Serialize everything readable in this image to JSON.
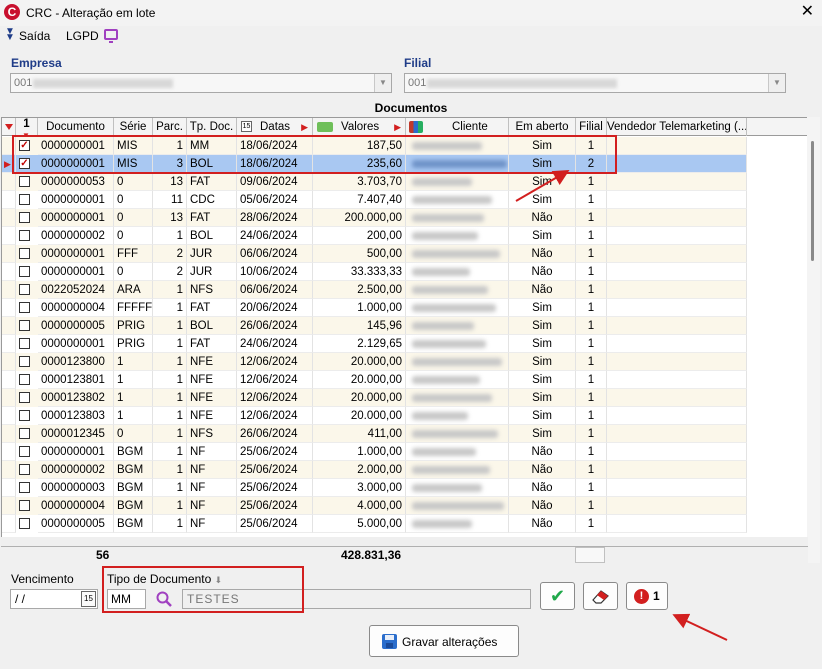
{
  "window": {
    "title": "CRC - Alteração em lote",
    "logo_letter": "C",
    "close_glyph": "✕"
  },
  "toolbar": {
    "exit_label": "Saída",
    "lgpd_label": "LGPD"
  },
  "empresa": {
    "label": "Empresa",
    "code": "001"
  },
  "filial": {
    "label": "Filial",
    "code": "001"
  },
  "grid": {
    "title": "Documentos",
    "select_count": "1",
    "columns": [
      "Documento",
      "Série",
      "Parc.",
      "Tp. Doc.",
      "Datas",
      "Valores",
      "Cliente",
      "Em aberto",
      "Filial",
      "Vendedor Telemarketing (..."
    ],
    "rows": [
      {
        "checked": true,
        "documento": "0000000001",
        "serie": "MIS",
        "parc": "1",
        "tp_doc": "MM",
        "data": "18/06/2024",
        "valor": "187,50",
        "em_aberto": "Sim",
        "filial": "1"
      },
      {
        "checked": true,
        "documento": "0000000001",
        "serie": "MIS",
        "parc": "3",
        "tp_doc": "BOL",
        "data": "18/06/2024",
        "valor": "235,60",
        "em_aberto": "Sim",
        "filial": "2"
      },
      {
        "checked": false,
        "documento": "0000000053",
        "serie": "0",
        "parc": "13",
        "tp_doc": "FAT",
        "data": "09/06/2024",
        "valor": "3.703,70",
        "em_aberto": "Sim",
        "filial": "1"
      },
      {
        "checked": false,
        "documento": "0000000001",
        "serie": "0",
        "parc": "11",
        "tp_doc": "CDC",
        "data": "05/06/2024",
        "valor": "7.407,40",
        "em_aberto": "Sim",
        "filial": "1"
      },
      {
        "checked": false,
        "documento": "0000000001",
        "serie": "0",
        "parc": "13",
        "tp_doc": "FAT",
        "data": "28/06/2024",
        "valor": "200.000,00",
        "em_aberto": "Não",
        "filial": "1"
      },
      {
        "checked": false,
        "documento": "0000000002",
        "serie": "0",
        "parc": "1",
        "tp_doc": "BOL",
        "data": "24/06/2024",
        "valor": "200,00",
        "em_aberto": "Sim",
        "filial": "1"
      },
      {
        "checked": false,
        "documento": "0000000001",
        "serie": "FFF",
        "parc": "2",
        "tp_doc": "JUR",
        "data": "06/06/2024",
        "valor": "500,00",
        "em_aberto": "Não",
        "filial": "1"
      },
      {
        "checked": false,
        "documento": "0000000001",
        "serie": "0",
        "parc": "2",
        "tp_doc": "JUR",
        "data": "10/06/2024",
        "valor": "33.333,33",
        "em_aberto": "Não",
        "filial": "1"
      },
      {
        "checked": false,
        "documento": "0022052024",
        "serie": "ARA",
        "parc": "1",
        "tp_doc": "NFS",
        "data": "06/06/2024",
        "valor": "2.500,00",
        "em_aberto": "Não",
        "filial": "1"
      },
      {
        "checked": false,
        "documento": "0000000004",
        "serie": "FFFFF",
        "parc": "1",
        "tp_doc": "FAT",
        "data": "20/06/2024",
        "valor": "1.000,00",
        "em_aberto": "Sim",
        "filial": "1"
      },
      {
        "checked": false,
        "documento": "0000000005",
        "serie": "PRIG",
        "parc": "1",
        "tp_doc": "BOL",
        "data": "26/06/2024",
        "valor": "145,96",
        "em_aberto": "Sim",
        "filial": "1"
      },
      {
        "checked": false,
        "documento": "0000000001",
        "serie": "PRIG",
        "parc": "1",
        "tp_doc": "FAT",
        "data": "24/06/2024",
        "valor": "2.129,65",
        "em_aberto": "Sim",
        "filial": "1"
      },
      {
        "checked": false,
        "documento": "0000123800",
        "serie": "1",
        "parc": "1",
        "tp_doc": "NFE",
        "data": "12/06/2024",
        "valor": "20.000,00",
        "em_aberto": "Sim",
        "filial": "1"
      },
      {
        "checked": false,
        "documento": "0000123801",
        "serie": "1",
        "parc": "1",
        "tp_doc": "NFE",
        "data": "12/06/2024",
        "valor": "20.000,00",
        "em_aberto": "Sim",
        "filial": "1"
      },
      {
        "checked": false,
        "documento": "0000123802",
        "serie": "1",
        "parc": "1",
        "tp_doc": "NFE",
        "data": "12/06/2024",
        "valor": "20.000,00",
        "em_aberto": "Sim",
        "filial": "1"
      },
      {
        "checked": false,
        "documento": "0000123803",
        "serie": "1",
        "parc": "1",
        "tp_doc": "NFE",
        "data": "12/06/2024",
        "valor": "20.000,00",
        "em_aberto": "Sim",
        "filial": "1"
      },
      {
        "checked": false,
        "documento": "0000012345",
        "serie": "0",
        "parc": "1",
        "tp_doc": "NFS",
        "data": "26/06/2024",
        "valor": "411,00",
        "em_aberto": "Sim",
        "filial": "1"
      },
      {
        "checked": false,
        "documento": "0000000001",
        "serie": "BGM",
        "parc": "1",
        "tp_doc": "NF",
        "data": "25/06/2024",
        "valor": "1.000,00",
        "em_aberto": "Não",
        "filial": "1"
      },
      {
        "checked": false,
        "documento": "0000000002",
        "serie": "BGM",
        "parc": "1",
        "tp_doc": "NF",
        "data": "25/06/2024",
        "valor": "2.000,00",
        "em_aberto": "Não",
        "filial": "1"
      },
      {
        "checked": false,
        "documento": "0000000003",
        "serie": "BGM",
        "parc": "1",
        "tp_doc": "NF",
        "data": "25/06/2024",
        "valor": "3.000,00",
        "em_aberto": "Não",
        "filial": "1"
      },
      {
        "checked": false,
        "documento": "0000000004",
        "serie": "BGM",
        "parc": "1",
        "tp_doc": "NF",
        "data": "25/06/2024",
        "valor": "4.000,00",
        "em_aberto": "Não",
        "filial": "1"
      },
      {
        "checked": false,
        "documento": "0000000005",
        "serie": "BGM",
        "parc": "1",
        "tp_doc": "NF",
        "data": "25/06/2024",
        "valor": "5.000,00",
        "em_aberto": "Não",
        "filial": "1"
      }
    ],
    "selected_row_index": 1,
    "footer": {
      "count": "56",
      "total": "428.831,36"
    }
  },
  "vencimento": {
    "label": "Vencimento",
    "value": " / /",
    "calendar_glyph": "15"
  },
  "tipo_documento": {
    "label": "Tipo de Documento",
    "code": "MM",
    "description": "TESTES"
  },
  "actions": {
    "confirm_glyph": "✔",
    "error_count": "1",
    "save_label": "Gravar alterações"
  },
  "colors": {
    "highlight": "#d21f1f",
    "selected_row": "#a9c8f2",
    "alt_row": "#fbf7ea",
    "accent_blue": "#1f3c88"
  }
}
